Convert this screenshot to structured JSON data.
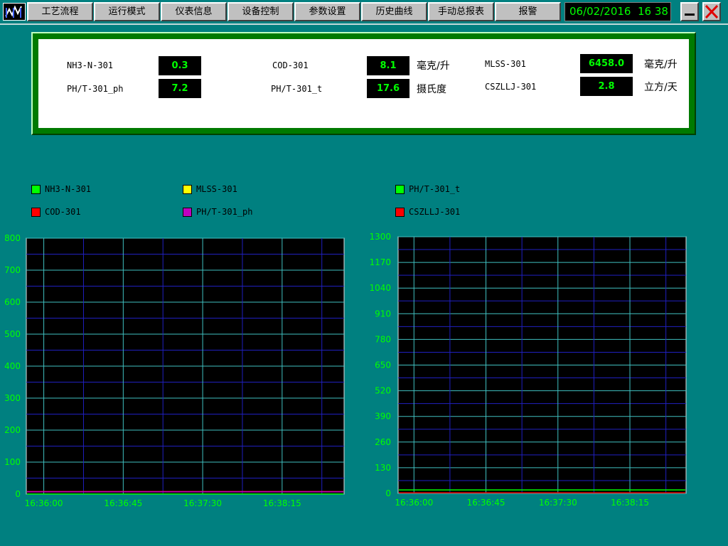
{
  "menu": [
    {
      "id": "process",
      "label": "工艺流程"
    },
    {
      "id": "run-mode",
      "label": "运行模式"
    },
    {
      "id": "meter-info",
      "label": "仪表信息"
    },
    {
      "id": "device-control",
      "label": "设备控制"
    },
    {
      "id": "param-settings",
      "label": "参数设置"
    },
    {
      "id": "history-curve",
      "label": "历史曲线"
    },
    {
      "id": "manual-report",
      "label": "手动总报表"
    },
    {
      "id": "alarm",
      "label": "报警"
    }
  ],
  "clock": {
    "date": "06/02/2016",
    "time": "16 38"
  },
  "icons": {
    "logo": "chart-logo-icon",
    "minimize": "minimize-icon",
    "close": "close-icon"
  },
  "readings": [
    {
      "tag": "NH3-N-301",
      "value": "0.3",
      "unit": ""
    },
    {
      "tag": "PH/T-301_ph",
      "value": "7.2",
      "unit": ""
    },
    {
      "tag": "COD-301",
      "value": "8.1",
      "unit": "毫克/升"
    },
    {
      "tag": "PH/T-301_t",
      "value": "17.6",
      "unit": "摄氏度"
    },
    {
      "tag": "MLSS-301",
      "value": "6458.0",
      "unit": "毫克/升"
    },
    {
      "tag": "CSZLLJ-301",
      "value": "2.8",
      "unit": "立方/天"
    }
  ],
  "legend_left": [
    {
      "name": "NH3-N-301",
      "color": "#00ff00"
    },
    {
      "name": "MLSS-301",
      "color": "#ffff00"
    },
    {
      "name": "COD-301",
      "color": "#ff0000"
    },
    {
      "name": "PH/T-301_ph",
      "color": "#c000c0"
    }
  ],
  "legend_right": [
    {
      "name": "PH/T-301_t",
      "color": "#00ff00"
    },
    {
      "name": "CSZLLJ-301",
      "color": "#ff0000"
    }
  ],
  "chart_data": [
    {
      "type": "line",
      "ylim": [
        0,
        800
      ],
      "yticks": [
        "0",
        "100",
        "200",
        "300",
        "400",
        "500",
        "600",
        "700",
        "800"
      ],
      "xticks": [
        "16:36:00",
        "16:36:45",
        "16:37:30",
        "16:38:15"
      ],
      "series": [
        {
          "name": "NH3-N-301",
          "color": "#00ff00",
          "level": 0.3
        },
        {
          "name": "MLSS-301",
          "color": "#ffff00",
          "level": null
        },
        {
          "name": "COD-301",
          "color": "#ff0000",
          "level": 8.1
        },
        {
          "name": "PH/T-301_ph",
          "color": "#c000c0",
          "level": 7.2
        }
      ]
    },
    {
      "type": "line",
      "ylim": [
        0,
        1300
      ],
      "yticks": [
        "0",
        "130",
        "260",
        "390",
        "520",
        "650",
        "780",
        "910",
        "1040",
        "1170",
        "1300"
      ],
      "xticks": [
        "16:36:00",
        "16:36:45",
        "16:37:30",
        "16:38:15"
      ],
      "series": [
        {
          "name": "PH/T-301_t",
          "color": "#00ff00",
          "level": 17.6
        },
        {
          "name": "CSZLLJ-301",
          "color": "#ff0000",
          "level": 2.8
        }
      ]
    }
  ]
}
